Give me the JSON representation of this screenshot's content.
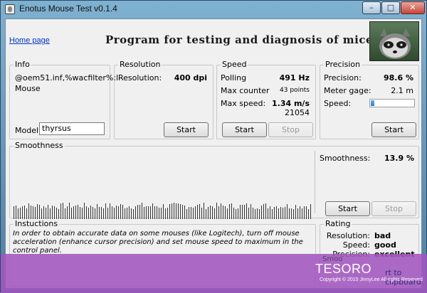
{
  "window": {
    "title": "Enotus Mouse Test v0.1.4",
    "minimize_glyph": "–",
    "maximize_glyph": "□",
    "close_glyph": "✕"
  },
  "header": {
    "home_link": "Home page",
    "banner": "Program for testing and diagnosis of mice"
  },
  "info": {
    "title": "Info",
    "driver_line1": "@oem51.inf,%wacfilter%;l",
    "driver_line2": "Mouse",
    "model_label": "Model:",
    "model_value": "thyrsus"
  },
  "resolution": {
    "title": "Resolution",
    "label": "Resolution:",
    "value": "400 dpi",
    "start": "Start"
  },
  "speed": {
    "title": "Speed",
    "polling_label": "Polling",
    "polling_value": "491 Hz",
    "max_counter_label": "Max counter",
    "max_counter_value": "43 points",
    "max_speed_label": "Max  speed:",
    "max_speed_value": "1.34 m/s",
    "max_speed_count": "21054",
    "start": "Start",
    "stop": "Stop"
  },
  "precision": {
    "title": "Precision",
    "precision_label": "Precision:",
    "precision_value": "98.6 %",
    "meter_label": "Meter gage:",
    "meter_value": "2.1 m",
    "speed_label": "Speed:",
    "speed_level": 0.08,
    "start": "Start"
  },
  "smoothness": {
    "title": "Smoothness",
    "label": "Smoothness:",
    "value": "13.9 %",
    "start": "Start",
    "stop": "Stop"
  },
  "instructions": {
    "title": "Instuctions",
    "text": "In order to obtain accurate data on some mouses (like Logitech), turn off mouse acceleration (enhance cursor precision) and set mouse speed to maximum in the control panel."
  },
  "rating": {
    "title": "Rating",
    "resolution_label": "Resolution:",
    "resolution_value": "bad",
    "speed_label": "Speed:",
    "speed_value": "good",
    "precision_label": "Precision:",
    "precision_value": "excellent",
    "clipboard_partial": "rt to clipboard"
  },
  "watermark": {
    "brand": "TESORO",
    "copyright": "Copyright © 2015 JinnyLee All rights Reserved"
  },
  "colors": {
    "overlay": "#a055be",
    "link": "#0033cc",
    "gauge": "#2c7cc7"
  }
}
